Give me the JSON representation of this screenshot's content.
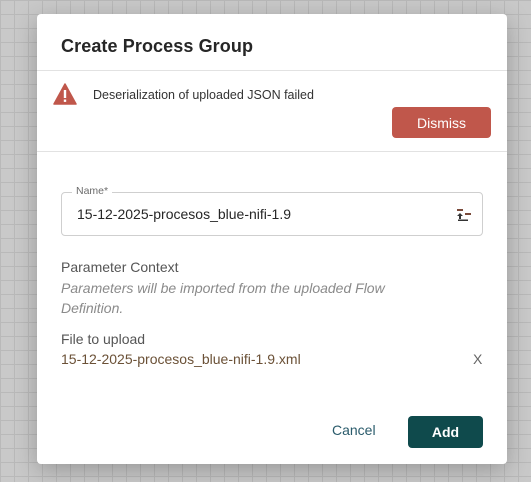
{
  "dialog": {
    "title": "Create Process Group",
    "error": {
      "icon": "warning-triangle-icon",
      "message": "Deserialization of uploaded JSON failed",
      "dismiss_label": "Dismiss"
    },
    "name_field": {
      "label": "Name",
      "required_marker": "*",
      "value": "15-12-2025-procesos_blue-nifi-1.9",
      "icon": "upload-flow-icon"
    },
    "parameter_context": {
      "label": "Parameter Context",
      "note": "Parameters will be imported from the uploaded Flow Definition."
    },
    "file_upload": {
      "label": "File to upload",
      "file_name": "15-12-2025-procesos_blue-nifi-1.9.xml",
      "remove_label": "X"
    },
    "actions": {
      "cancel_label": "Cancel",
      "add_label": "Add"
    }
  },
  "colors": {
    "dismiss_bg": "#c0574b",
    "add_bg": "#0f4a4c",
    "error_icon": "#c0574b"
  }
}
